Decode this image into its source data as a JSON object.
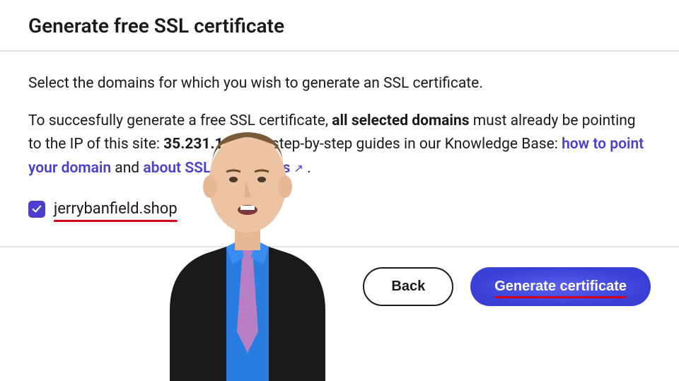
{
  "page_title": "Generate free SSL certificate",
  "instruction": "Select the domains for which you wish to generate an SSL certificate.",
  "info": {
    "prefix": "To succesfully generate a free SSL certificate, ",
    "bold1": "all selected domains",
    "mid1": " must already be pointing to the IP of this site: ",
    "ip": "35.231.13",
    "mid2": ". Find step-by-step guides in our Knowledge Base: ",
    "link1": "how to point your domain",
    "and": " and ",
    "link2": "about SSL certificates",
    "end": " ."
  },
  "domain": {
    "checked": true,
    "name": "jerrybanfield.shop"
  },
  "buttons": {
    "back": "Back",
    "generate": "Generate certificate"
  }
}
